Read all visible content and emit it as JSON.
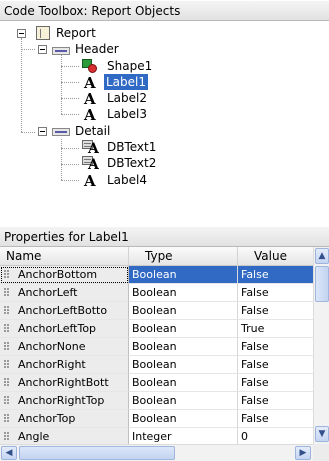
{
  "toolbox": {
    "title": "Code Toolbox: Report Objects"
  },
  "tree": {
    "report": "Report",
    "header": "Header",
    "shape1": "Shape1",
    "label1": "Label1",
    "label2": "Label2",
    "label3": "Label3",
    "detail": "Detail",
    "dbtext1": "DBText1",
    "dbtext2": "DBText2",
    "label4": "Label4",
    "expander_open": "−"
  },
  "properties": {
    "title": "Properties for Label1",
    "columns": {
      "name": "Name",
      "type": "Type",
      "value": "Value"
    },
    "rows": [
      {
        "name": "AnchorBottom",
        "type": "Boolean",
        "value": "False"
      },
      {
        "name": "AnchorLeft",
        "type": "Boolean",
        "value": "False"
      },
      {
        "name": "AnchorLeftBotto",
        "type": "Boolean",
        "value": "False"
      },
      {
        "name": "AnchorLeftTop",
        "type": "Boolean",
        "value": "True"
      },
      {
        "name": "AnchorNone",
        "type": "Boolean",
        "value": "False"
      },
      {
        "name": "AnchorRight",
        "type": "Boolean",
        "value": "False"
      },
      {
        "name": "AnchorRightBott",
        "type": "Boolean",
        "value": "False"
      },
      {
        "name": "AnchorRightTop",
        "type": "Boolean",
        "value": "False"
      },
      {
        "name": "AnchorTop",
        "type": "Boolean",
        "value": "False"
      },
      {
        "name": "Angle",
        "type": "Integer",
        "value": "0"
      }
    ]
  },
  "scroll": {
    "up": "▲",
    "down": "▼",
    "left": "◀",
    "right": "▶"
  }
}
